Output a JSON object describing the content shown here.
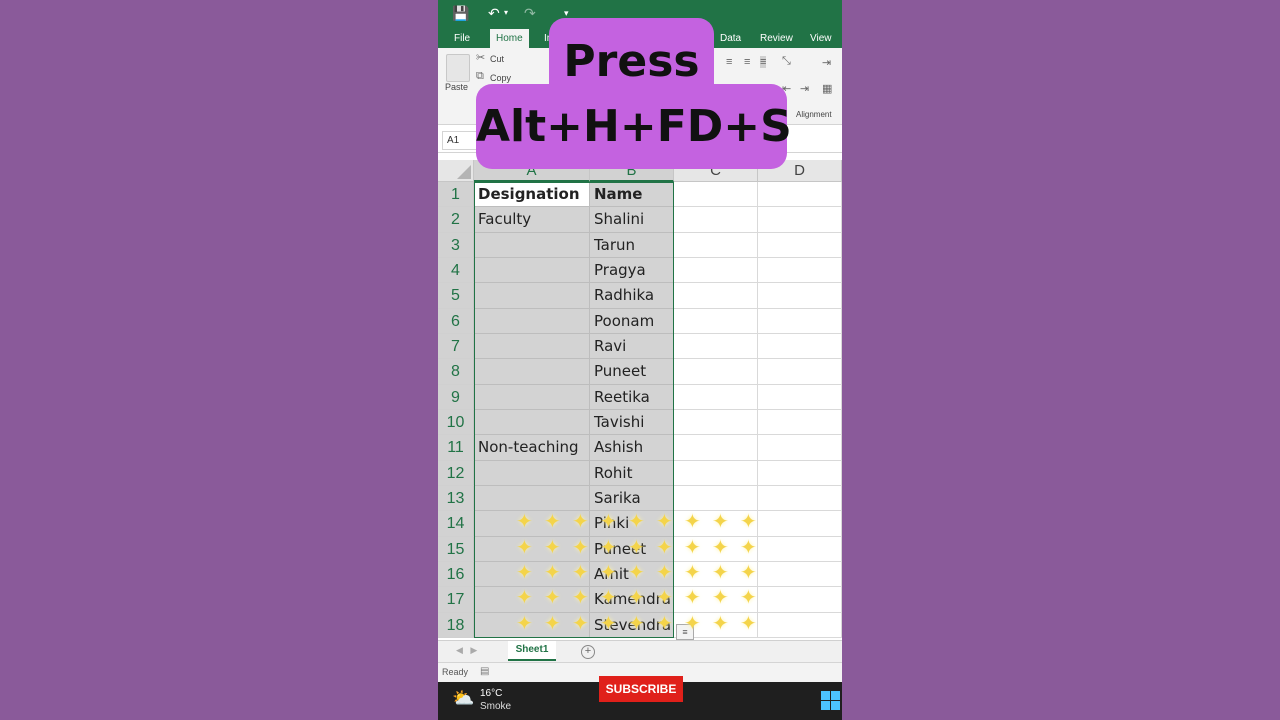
{
  "quick_access": {
    "save_icon": "save-icon",
    "undo_icon": "undo-icon",
    "redo_icon": "redo-icon"
  },
  "ribbon_tabs": [
    {
      "label": "File"
    },
    {
      "label": "Home"
    },
    {
      "label": "In"
    },
    {
      "label": "Data"
    },
    {
      "label": "Review"
    },
    {
      "label": "View"
    }
  ],
  "ribbon": {
    "paste_label": "Paste",
    "cut_label": "Cut",
    "copy_label": "Copy",
    "alignment_label": "Alignment"
  },
  "formula_bar": {
    "name_box": "A1"
  },
  "columns": [
    "A",
    "B",
    "C",
    "D"
  ],
  "rows": [
    {
      "n": "1",
      "a": "Designation",
      "b": "Name"
    },
    {
      "n": "2",
      "a": "Faculty",
      "b": "Shalini"
    },
    {
      "n": "3",
      "a": "",
      "b": "Tarun"
    },
    {
      "n": "4",
      "a": "",
      "b": "Pragya"
    },
    {
      "n": "5",
      "a": "",
      "b": "Radhika"
    },
    {
      "n": "6",
      "a": "",
      "b": "Poonam"
    },
    {
      "n": "7",
      "a": "",
      "b": "Ravi"
    },
    {
      "n": "8",
      "a": "",
      "b": "Puneet"
    },
    {
      "n": "9",
      "a": "",
      "b": "Reetika"
    },
    {
      "n": "10",
      "a": "",
      "b": "Tavishi"
    },
    {
      "n": "11",
      "a": "Non-teaching",
      "b": "Ashish"
    },
    {
      "n": "12",
      "a": "",
      "b": "Rohit"
    },
    {
      "n": "13",
      "a": "",
      "b": "Sarika"
    },
    {
      "n": "14",
      "a": "",
      "b": "Pinki"
    },
    {
      "n": "15",
      "a": "",
      "b": "Puneet"
    },
    {
      "n": "16",
      "a": "",
      "b": "Amit"
    },
    {
      "n": "17",
      "a": "",
      "b": "Kamendra"
    },
    {
      "n": "18",
      "a": "",
      "b": "Stevendra"
    }
  ],
  "sheet_tabs": [
    {
      "label": "Sheet1"
    }
  ],
  "status": {
    "ready": "Ready"
  },
  "taskbar": {
    "temperature": "16°C",
    "condition": "Smoke",
    "subscribe_label": "SUBSCRIBE"
  },
  "overlay": {
    "line1": "Press",
    "line2": "Alt+H+FD+S"
  },
  "colors": {
    "excel_green": "#217346",
    "callout": "#c462e0",
    "background": "#8a5a9a",
    "subscribe_red": "#e0201a"
  }
}
